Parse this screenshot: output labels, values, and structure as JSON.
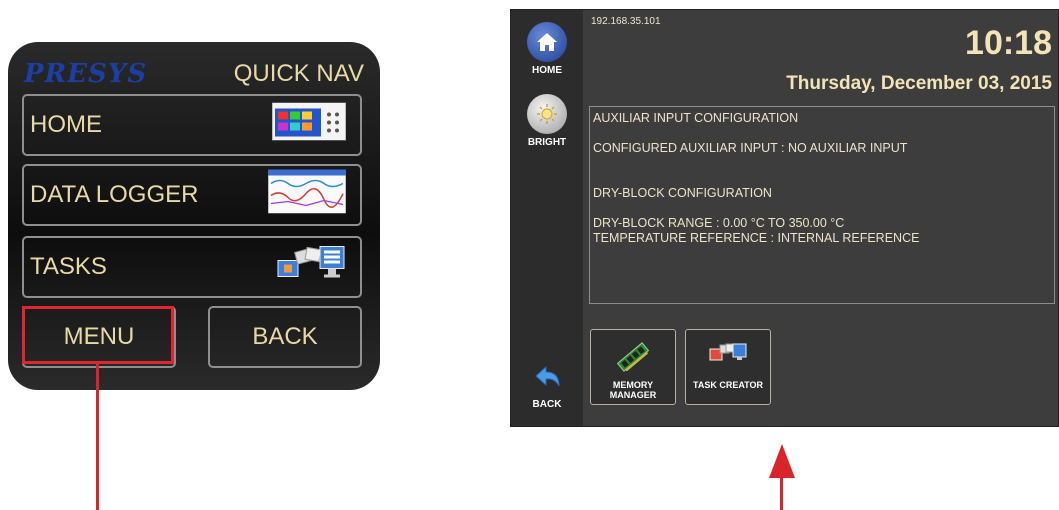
{
  "quick_nav": {
    "brand": "PRESYS",
    "title": "QUICK NAV",
    "items": [
      {
        "label": "HOME",
        "icon": "home-screen-thumbnail-icon"
      },
      {
        "label": "DATA LOGGER",
        "icon": "chart-thumbnail-icon"
      },
      {
        "label": "TASKS",
        "icon": "tasks-computers-icon"
      }
    ],
    "menu_label": "MENU",
    "back_label": "BACK"
  },
  "device": {
    "ip": "192.168.35.101",
    "time": "10:18",
    "date": "Thursday, December 03, 2015",
    "sidebar": {
      "home_label": "HOME",
      "bright_label": "BRIGHT",
      "back_label": "BACK"
    },
    "info_lines": [
      "AUXILIAR INPUT CONFIGURATION",
      "",
      "CONFIGURED AUXILIAR INPUT : NO AUXILIAR INPUT",
      "",
      "",
      "DRY-BLOCK CONFIGURATION",
      "",
      "DRY-BLOCK RANGE : 0.00 °C TO 350.00 °C",
      "TEMPERATURE REFERENCE : INTERNAL REFERENCE"
    ],
    "tiles": [
      {
        "label_line1": "MEMORY",
        "label_line2": "MANAGER",
        "icon": "memory-chip-icon"
      },
      {
        "label_line1": "TASK CREATOR",
        "label_line2": "",
        "icon": "task-creator-icon"
      }
    ]
  },
  "colors": {
    "highlight": "#e0262e",
    "text_gold": "#e8d9a8",
    "brand_blue": "#1c3fa3"
  }
}
